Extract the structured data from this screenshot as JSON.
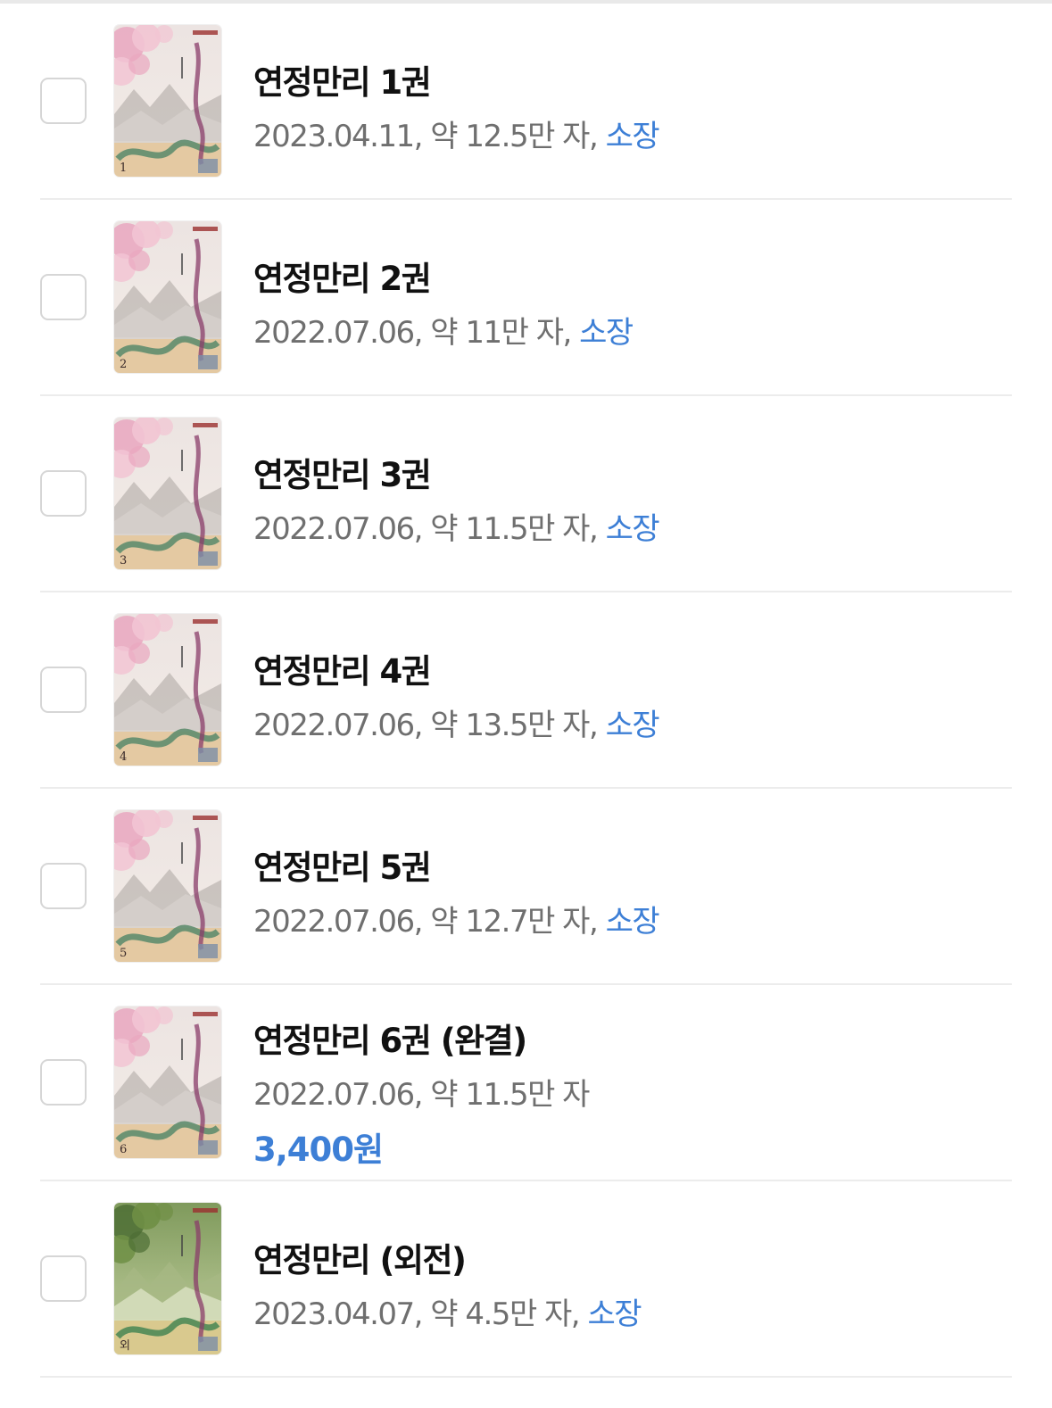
{
  "colors": {
    "accent": "#3d7fd6",
    "meta_text": "#6f6f6f",
    "title_text": "#111111",
    "divider": "#ececec"
  },
  "items": [
    {
      "title": "연정만리 1권",
      "meta": "2023.04.11, 약 12.5만 자, ",
      "status": "소장",
      "cover_number": "1",
      "cover_theme": "blossom"
    },
    {
      "title": "연정만리 2권",
      "meta": "2022.07.06, 약 11만 자, ",
      "status": "소장",
      "cover_number": "2",
      "cover_theme": "blossom"
    },
    {
      "title": "연정만리 3권",
      "meta": "2022.07.06, 약 11.5만 자, ",
      "status": "소장",
      "cover_number": "3",
      "cover_theme": "blossom"
    },
    {
      "title": "연정만리 4권",
      "meta": "2022.07.06, 약 13.5만 자, ",
      "status": "소장",
      "cover_number": "4",
      "cover_theme": "blossom"
    },
    {
      "title": "연정만리 5권",
      "meta": "2022.07.06, 약 12.7만 자, ",
      "status": "소장",
      "cover_number": "5",
      "cover_theme": "blossom"
    },
    {
      "title": "연정만리 6권 (완결)",
      "meta": "2022.07.06, 약 11.5만 자",
      "status": "",
      "price": "3,400원",
      "cover_number": "6",
      "cover_theme": "blossom"
    },
    {
      "title": "연정만리 (외전)",
      "meta": "2023.04.07, 약 4.5만 자, ",
      "status": "소장",
      "cover_number": "외",
      "cover_theme": "green"
    }
  ]
}
